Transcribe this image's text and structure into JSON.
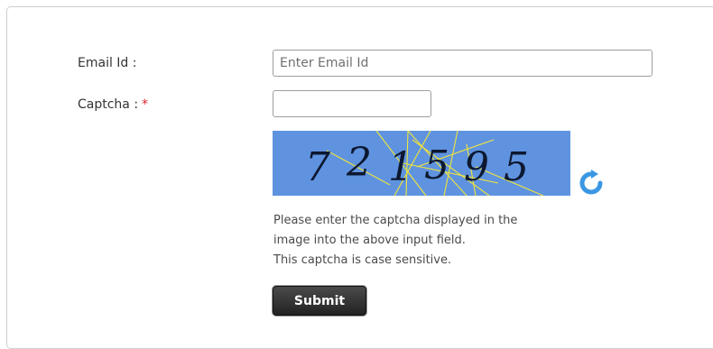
{
  "form": {
    "email_label": "Email Id :",
    "email_placeholder": "Enter Email Id",
    "email_value": "",
    "captcha_label": "Captcha :",
    "required_marker": "*",
    "captcha_value": "",
    "captcha_code": "721595",
    "help_lines": [
      "Please enter the captcha displayed in the",
      "image into the above input field.",
      "This captcha is case sensitive."
    ],
    "submit_label": "Submit",
    "refresh_icon": "refresh-icon"
  },
  "colors": {
    "captcha_bg": "#5f93e0",
    "captcha_text": "#0d1830",
    "captcha_noise": "#f0e63a",
    "refresh": "#3b97e3",
    "required": "#e0262e"
  }
}
